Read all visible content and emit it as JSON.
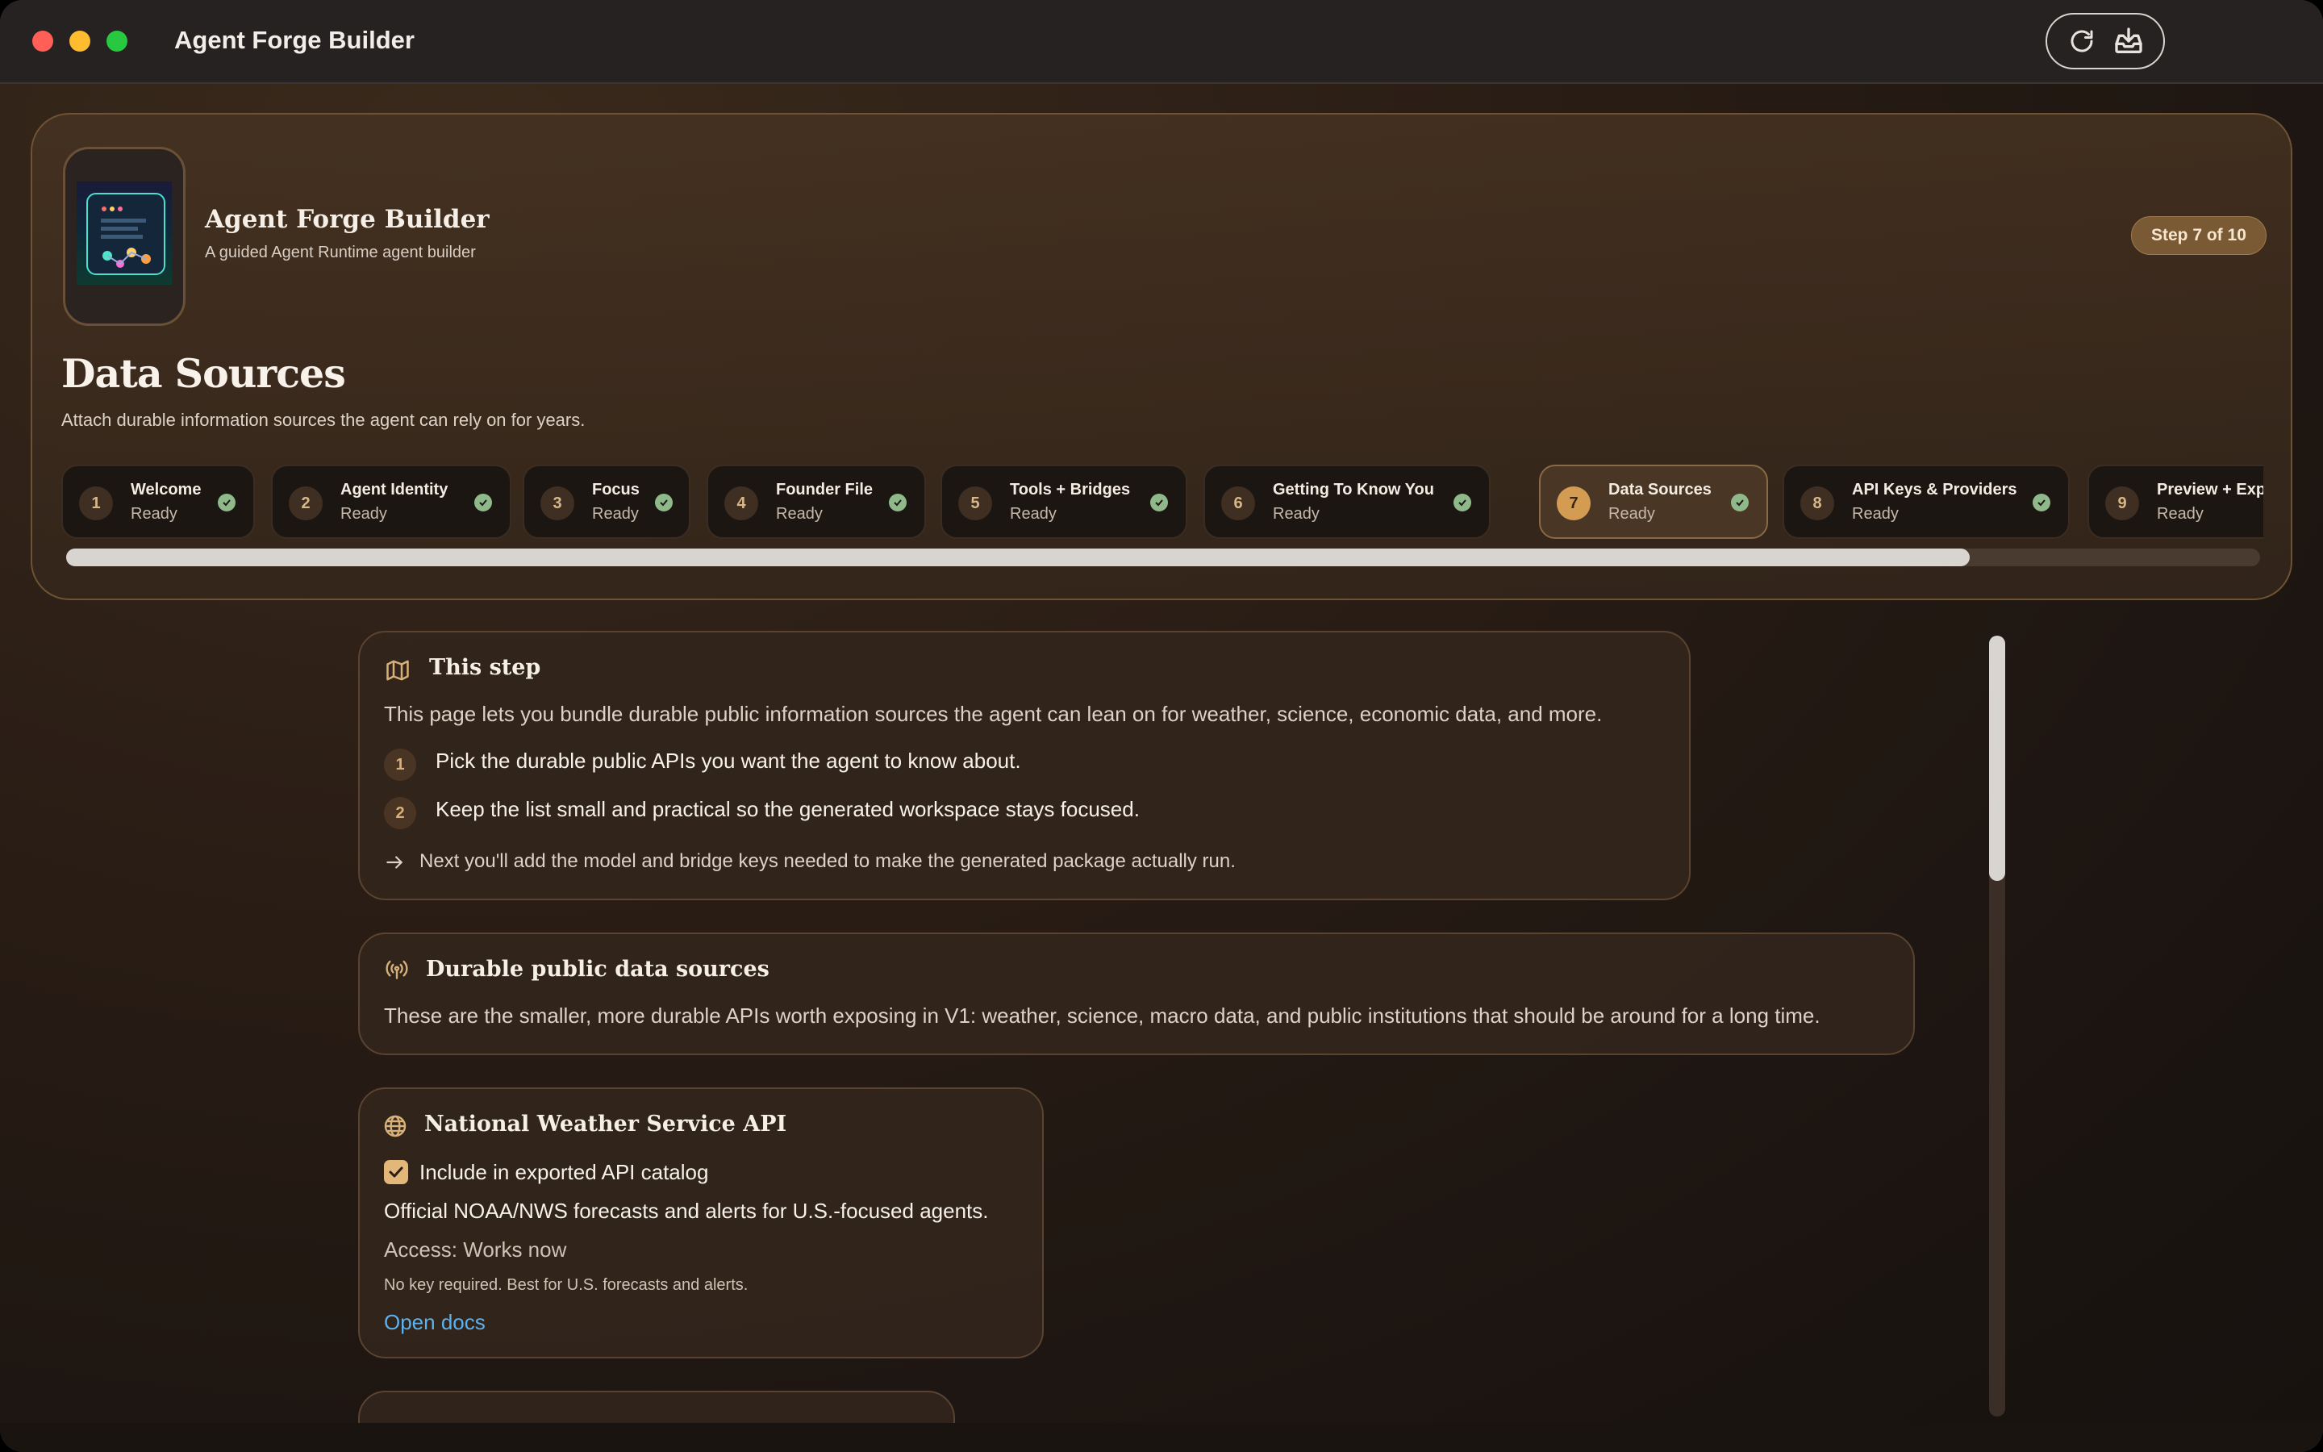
{
  "window": {
    "title": "Agent Forge Builder"
  },
  "toolbar": {
    "refresh_icon": "refresh-icon",
    "download_icon": "download-tray-icon"
  },
  "header": {
    "app_name": "Agent Forge Builder",
    "app_subtitle": "A guided Agent Runtime agent builder",
    "step_badge": "Step 7 of 10",
    "page_title": "Data Sources",
    "page_description": "Attach durable information sources the agent can rely on for years."
  },
  "steps": [
    {
      "num": "1",
      "label": "Welcome",
      "status": "Ready"
    },
    {
      "num": "2",
      "label": "Agent Identity",
      "status": "Ready"
    },
    {
      "num": "3",
      "label": "Focus",
      "status": "Ready"
    },
    {
      "num": "4",
      "label": "Founder File",
      "status": "Ready"
    },
    {
      "num": "5",
      "label": "Tools + Bridges",
      "status": "Ready"
    },
    {
      "num": "6",
      "label": "Getting To Know You",
      "status": "Ready"
    },
    {
      "num": "7",
      "label": "Data Sources",
      "status": "Ready"
    },
    {
      "num": "8",
      "label": "API Keys & Providers",
      "status": "Ready"
    },
    {
      "num": "9",
      "label": "Preview + Export",
      "status": "Ready"
    }
  ],
  "this_step": {
    "title": "This step",
    "description": "This page lets you bundle durable public information sources the agent can lean on for weather, science, economic data, and more.",
    "items": [
      {
        "num": "1",
        "text": "Pick the durable public APIs you want the agent to know about."
      },
      {
        "num": "2",
        "text": "Keep the list small and practical so the generated workspace stays focused."
      }
    ],
    "next": "Next you'll add the model and bridge keys needed to make the generated package actually run."
  },
  "durable": {
    "title": "Durable public data sources",
    "description": "These are the smaller, more durable APIs worth exposing in V1: weather, science, macro data, and public institutions that should be around for a long time."
  },
  "nws": {
    "title": "National Weather Service API",
    "checkbox_label": "Include in exported API catalog",
    "checked": true,
    "summary": "Official NOAA/NWS forecasts and alerts for U.S.-focused agents.",
    "access": "Access: Works now",
    "note": "No key required. Best for U.S. forecasts and alerts.",
    "link": "Open docs"
  },
  "colors": {
    "accent": "#d49c52",
    "link": "#5ab2f0",
    "check": "#8fb98a"
  }
}
